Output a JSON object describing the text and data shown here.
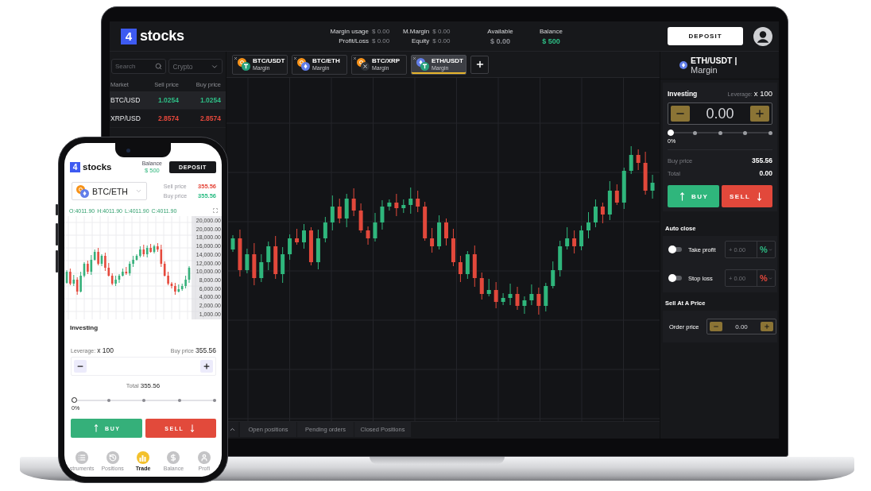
{
  "laptop": {
    "header": {
      "logo": {
        "mark": "4",
        "name": "stocks"
      },
      "stats": [
        {
          "label": "Margin usage",
          "value": "$ 0.00"
        },
        {
          "label": "Profit/Loss",
          "value": "$ 0.00"
        },
        {
          "label": "M.Margin",
          "value": "$ 0.00"
        },
        {
          "label": "Equity",
          "value": "$ 0.00"
        }
      ],
      "summary": [
        {
          "label": "Available",
          "value": "$ 0.00",
          "color": "#8a8c92"
        },
        {
          "label": "Balance",
          "value": "$ 500",
          "color": "#2ebd85"
        }
      ],
      "deposit_button": "DEPOSIT"
    },
    "market": {
      "search": {
        "placeholder": "Search"
      },
      "filter": {
        "value": "Crypto"
      },
      "columns": [
        "Market",
        "Sell price",
        "Buy price"
      ],
      "rows": [
        {
          "market": "BTC/USD",
          "sell": "1.0254",
          "buy": "1.0254",
          "color": "#2ebd85",
          "selected": true
        },
        {
          "market": "XRP/USD",
          "sell": "2.8574",
          "buy": "2.8574",
          "color": "#e5483c",
          "selected": false
        }
      ]
    },
    "tabs": [
      {
        "pair": "BTC/USDT",
        "mode": "Margin",
        "selected": false
      },
      {
        "pair": "BTC/ETH",
        "mode": "Margin",
        "selected": false
      },
      {
        "pair": "BTC/XRP",
        "mode": "Margin",
        "selected": false
      },
      {
        "pair": "ETH/USDT",
        "mode": "Margin",
        "selected": true
      }
    ],
    "bottom_tabs": [
      {
        "label": "Open positions",
        "selected": false
      },
      {
        "label": "Pending orders",
        "selected": false
      },
      {
        "label": "Closed Positions",
        "selected": false
      }
    ],
    "right_panel": {
      "pair": "ETH/USDT |",
      "mode": "Margin",
      "investing": {
        "title": "Investing",
        "leverage_label": "Leverage:",
        "leverage_value": "x 100",
        "amount": "0.00",
        "level": 0,
        "percent": "0%",
        "rows": [
          {
            "label": "Buy price",
            "value": "355.56"
          },
          {
            "label": "Total",
            "value": "0.00"
          }
        ],
        "buy_button": "BUY",
        "sell_button": "SELL"
      },
      "auto_close": {
        "title": "Auto close",
        "rows": [
          {
            "label": "Take profit",
            "on": false,
            "placeholder": "+ 0.00",
            "unit": "%",
            "color": "#2ebd85"
          },
          {
            "label": "Stop loss",
            "on": false,
            "placeholder": "+ 0.00",
            "unit": "%",
            "color": "#e5483c"
          }
        ]
      },
      "sell_at_price": {
        "title": "Sell At A Price",
        "label": "Order price",
        "value": "0.00"
      }
    }
  },
  "phone": {
    "header": {
      "logo": {
        "mark": "4",
        "name": "stocks"
      },
      "balance_label": "Balance",
      "balance": "$ 500",
      "deposit_button": "DEPOSIT"
    },
    "pair_selector": {
      "value": "BTC/ETH"
    },
    "prices": [
      {
        "label": "Sell price",
        "value": "355.56",
        "color": "#e5483c"
      },
      {
        "label": "Buy price",
        "value": "355.56",
        "color": "#2ebd85"
      }
    ],
    "chart": {
      "ohlc": [
        "O:4011.90",
        "H:4011.90",
        "L:4011.90",
        "C:4011.90"
      ],
      "y_labels": [
        "20,000.00",
        "20,000.00",
        "18,000.00",
        "16,000.00",
        "14,000.00",
        "12,000.00",
        "10,000.00",
        "8,000.00",
        "6,000.00",
        "4,000.00",
        "2,000.00",
        "1,000.00"
      ]
    },
    "investing": {
      "title": "Investing",
      "leverage_label": "Leverage:",
      "leverage_value": "x 100",
      "buy_price_label": "Buy price",
      "buy_price": "355.56",
      "total_label": "Total",
      "total": "355.56",
      "level": 0,
      "percent": "0%",
      "buy_button": "BUY",
      "sell_button": "SELL"
    },
    "nav": [
      {
        "label": "struments",
        "selected": false
      },
      {
        "label": "Positions",
        "selected": false
      },
      {
        "label": "Trade",
        "selected": true
      },
      {
        "label": "Balance",
        "selected": false
      },
      {
        "label": "Profi",
        "selected": false
      }
    ]
  }
}
